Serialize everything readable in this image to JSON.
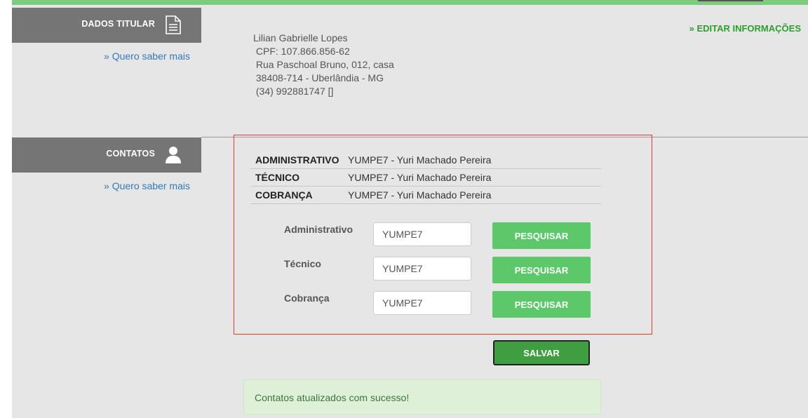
{
  "owner_section": {
    "title": "DADOS TITULAR",
    "more_link": "» Quero saber mais",
    "edit_link": "» EDITAR INFORMAÇÕES",
    "name": "Lilian Gabrielle Lopes",
    "cpf": " CPF: 107.866.856-62",
    "address": " Rua Paschoal Bruno, 012, casa",
    "city": " 38408-714 - Uberlândia - MG",
    "phone": " (34) 992881747 []"
  },
  "contacts_section": {
    "title": "CONTATOS",
    "more_link": "» Quero saber mais",
    "table": [
      {
        "role": "ADMINISTRATIVO",
        "value": "YUMPE7 - Yuri Machado Pereira"
      },
      {
        "role": "TÉCNICO",
        "value": "YUMPE7 - Yuri Machado Pereira"
      },
      {
        "role": "COBRANÇA",
        "value": "YUMPE7 - Yuri Machado Pereira"
      }
    ],
    "form": [
      {
        "label": "Administrativo",
        "value": "YUMPE7",
        "button": "PESQUISAR"
      },
      {
        "label": "Técnico",
        "value": "YUMPE7",
        "button": "PESQUISAR"
      },
      {
        "label": "Cobrança",
        "value": "YUMPE7",
        "button": "PESQUISAR"
      }
    ],
    "save_label": "SALVAR",
    "success_message": "Contatos atualizados com sucesso!"
  },
  "icons": {
    "owner": "document-icon",
    "contacts": "user-icon"
  },
  "colors": {
    "accent_green": "#5cc86a",
    "save_green": "#3f9e3f",
    "header_gray": "#757575",
    "highlight_red": "#e53935"
  }
}
